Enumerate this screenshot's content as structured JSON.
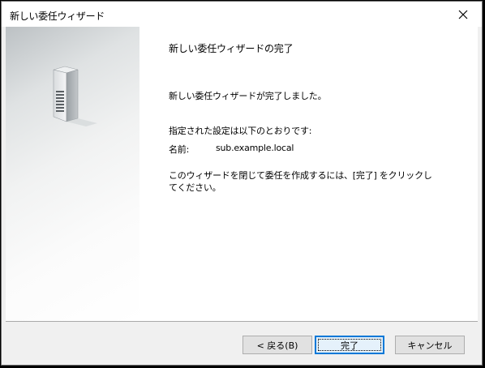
{
  "window": {
    "title": "新しい委任ウィザード"
  },
  "content": {
    "heading": "新しい委任ウィザードの完了",
    "completed_message": "新しい委任ウィザードが完了しました。",
    "settings_intro": "指定された設定は以下のとおりです:",
    "name_label": "名前:",
    "name_value": "sub.example.local",
    "instruction": "このウィザードを閉じて委任を作成するには、[完了] をクリックしてください。"
  },
  "buttons": {
    "back": "< 戻る(B)",
    "finish": "完了",
    "cancel": "キャンセル"
  },
  "icons": {
    "close": "close-icon",
    "server": "server-icon"
  }
}
